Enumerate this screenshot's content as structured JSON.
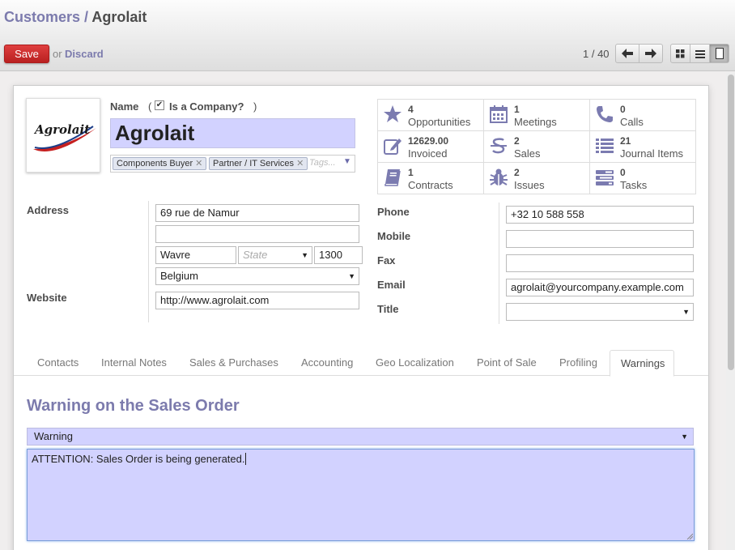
{
  "breadcrumb": {
    "parent": "Customers",
    "separator": "/",
    "current": "Agrolait"
  },
  "toolbar": {
    "save_label": "Save",
    "or_label": "or",
    "discard_label": "Discard"
  },
  "pager": {
    "text": "1 / 40"
  },
  "logo": {
    "text": "Agrolait"
  },
  "form": {
    "name_label": "Name",
    "is_company_label": "Is a Company?",
    "is_company_checked": true,
    "name_value": "Agrolait",
    "tags": [
      "Components Buyer",
      "Partner / IT Services"
    ],
    "tags_placeholder": "Tags...",
    "address_label": "Address",
    "street": "69 rue de Namur",
    "street2": "",
    "city": "Wavre",
    "state_placeholder": "State",
    "zip": "1300",
    "country": "Belgium",
    "website_label": "Website",
    "website": "http://www.agrolait.com",
    "phone_label": "Phone",
    "phone": "+32 10 588 558",
    "mobile_label": "Mobile",
    "mobile": "",
    "fax_label": "Fax",
    "fax": "",
    "email_label": "Email",
    "email": "agrolait@yourcompany.example.com",
    "title_label": "Title",
    "title": ""
  },
  "stats": [
    {
      "value": "4",
      "label": "Opportunities",
      "icon": "star-icon"
    },
    {
      "value": "1",
      "label": "Meetings",
      "icon": "calendar-icon"
    },
    {
      "value": "0",
      "label": "Calls",
      "icon": "phone-icon"
    },
    {
      "value": "12629.00",
      "label": "Invoiced",
      "icon": "edit-icon"
    },
    {
      "value": "2",
      "label": "Sales",
      "icon": "dollar-icon"
    },
    {
      "value": "21",
      "label": "Journal Items",
      "icon": "list-icon"
    },
    {
      "value": "1",
      "label": "Contracts",
      "icon": "book-icon"
    },
    {
      "value": "2",
      "label": "Issues",
      "icon": "bug-icon"
    },
    {
      "value": "0",
      "label": "Tasks",
      "icon": "tasks-icon"
    }
  ],
  "tabs": [
    "Contacts",
    "Internal Notes",
    "Sales & Purchases",
    "Accounting",
    "Geo Localization",
    "Point of Sale",
    "Profiling",
    "Warnings"
  ],
  "active_tab": "Warnings",
  "warning": {
    "section_title": "Warning on the Sales Order",
    "type": "Warning",
    "message": "ATTENTION: Sales Order is being generated."
  },
  "colors": {
    "accent": "#7c7bad",
    "save": "#c62828",
    "field_required": "#d2d2ff"
  }
}
